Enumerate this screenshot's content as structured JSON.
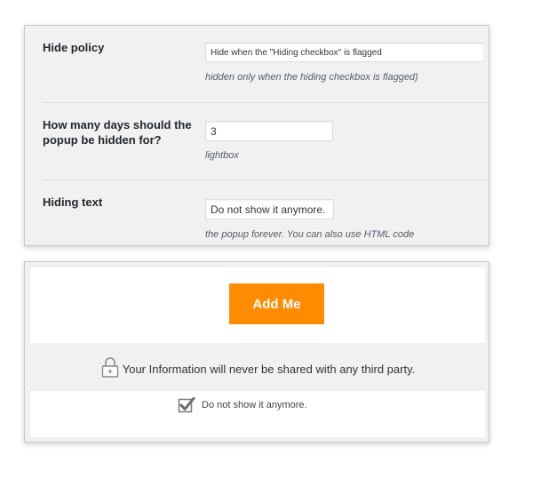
{
  "settings": {
    "hide_policy": {
      "label": "Hide policy",
      "value": "Hide when the \"Hiding checkbox\" is flagged",
      "description": "hidden only when the hiding checkbox is flagged)"
    },
    "days_hidden": {
      "label_line1": "How many days should the",
      "label_line2": "popup be hidden for?",
      "value": "3",
      "description": "lightbox"
    },
    "hiding_text": {
      "label": "Hiding text",
      "value": "Do not show it anymore.",
      "description": "the popup forever. You can also use HTML code"
    }
  },
  "popup": {
    "button_label": "Add Me",
    "button_color": "#ff8c00",
    "privacy_icon": "lock-icon",
    "privacy_text": "Your Information will never be shared with any third party.",
    "hide_checkbox": {
      "icon": "checkbox-checked-icon",
      "checked": true,
      "label": "Do not show it anymore."
    }
  }
}
